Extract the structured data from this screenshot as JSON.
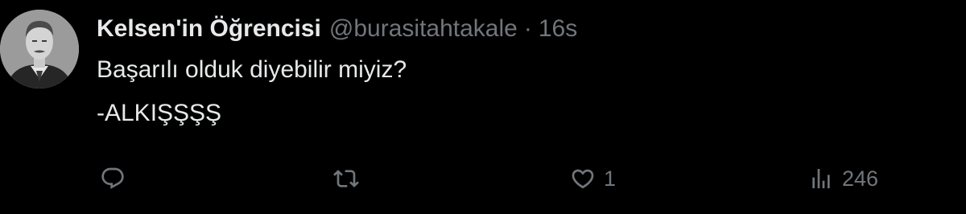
{
  "tweet": {
    "author": {
      "display_name": "Kelsen'in Öğrencisi",
      "handle": "@burasitahtakale"
    },
    "separator": "·",
    "timestamp": "16s",
    "text_lines": [
      "Başarılı olduk diyebilir miyiz?",
      "-ALKIŞŞŞŞ"
    ],
    "actions": {
      "reply": {
        "icon": "reply-icon"
      },
      "retweet": {
        "icon": "retweet-icon"
      },
      "like": {
        "icon": "heart-icon",
        "count": "1"
      },
      "views": {
        "icon": "views-icon",
        "count": "246"
      }
    }
  },
  "colors": {
    "background": "#000000",
    "primary_text": "#e7e9ea",
    "secondary_text": "#71767b"
  }
}
